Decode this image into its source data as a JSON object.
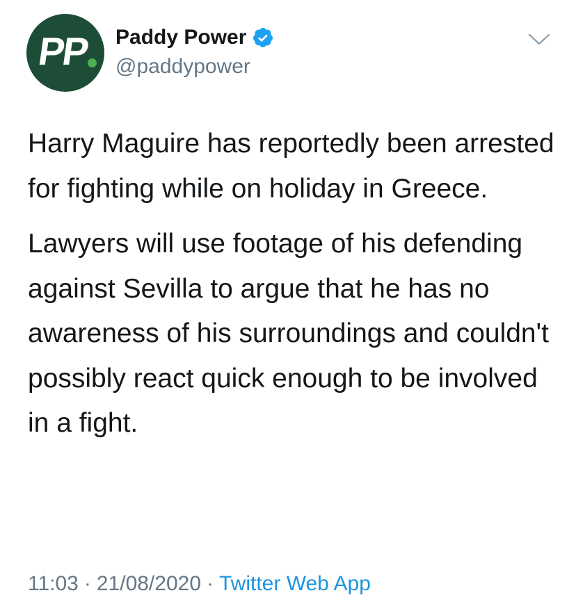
{
  "tweet": {
    "author": {
      "avatar_text": "PP",
      "display_name": "Paddy Power",
      "handle": "@paddypower",
      "verified": true
    },
    "text_paragraphs": [
      "Harry Maguire has reportedly been arrested for fighting while on holiday in Greece.",
      "Lawyers will use footage of his defending against Sevilla to argue that he has no awareness of his surroundings and couldn't possibly react quick enough to be involved in a fight."
    ],
    "meta": {
      "time": "11:03",
      "separator": "·",
      "date": "21/08/2020",
      "source": "Twitter Web App"
    }
  },
  "icons": {
    "verified": "verified-badge-icon",
    "menu": "chevron-down-icon"
  },
  "colors": {
    "avatar_bg": "#1d4d36",
    "avatar_dot": "#4caf50",
    "verified_blue": "#1da1f2",
    "link_blue": "#1b95e0",
    "secondary_text": "#657786",
    "primary_text": "#14171a"
  }
}
